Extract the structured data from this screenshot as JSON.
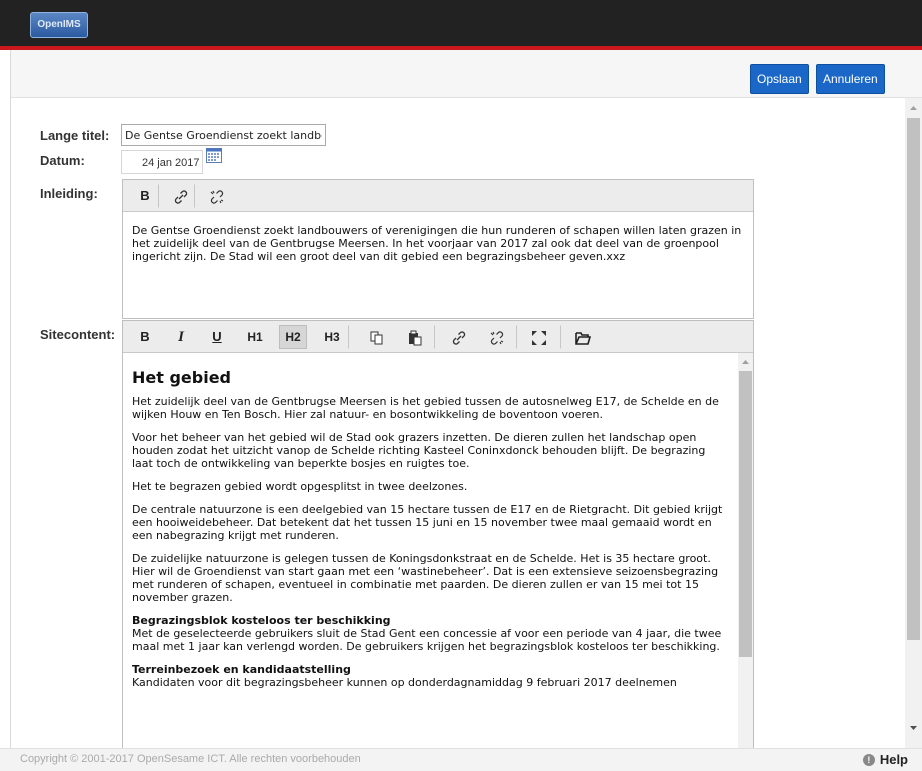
{
  "app": {
    "logo_text": "OpenIMS"
  },
  "actions": {
    "save_label": "Opslaan",
    "cancel_label": "Annuleren"
  },
  "form": {
    "long_title_label": "Lange titel:",
    "long_title_value": "De Gentse Groendienst zoekt landbc",
    "date_label": "Datum:",
    "date_value": "24 jan 2017",
    "intro_label": "Inleiding:",
    "intro_text": "De Gentse Groendienst zoekt landbouwers of verenigingen die hun runderen of schapen willen laten grazen in het zuidelijk deel van de Gentbrugse Meersen. In het voorjaar van 2017 zal ook dat deel van de groenpool ingericht zijn. De Stad wil een groot deel van dit gebied een begrazingsbeheer geven.xxz",
    "sitecontent_label": "Sitecontent:"
  },
  "intro_toolbar": {
    "bold": "B"
  },
  "site_toolbar": {
    "bold": "B",
    "italic": "I",
    "underline": "U",
    "h1": "H1",
    "h2": "H2",
    "h3": "H3"
  },
  "content": {
    "heading": "Het gebied",
    "p1": "Het zuidelijk deel van de Gentbrugse Meersen is het gebied tussen de autosnelweg E17, de Schelde en de wijken Houw en Ten Bosch. Hier zal natuur- en bosontwikkeling de boventoon voeren.",
    "p2": "Voor het beheer van het gebied wil de Stad ook grazers inzetten. De dieren zullen het landschap open houden zodat het uitzicht vanop de Schelde richting Kasteel Coninxdonck behouden blijft. De begrazing laat toch de ontwikkeling van beperkte bosjes en ruigtes toe.",
    "p3": "Het te begrazen gebied wordt opgesplitst in twee deelzones.",
    "p4": "De centrale natuurzone is een deelgebied van 15 hectare tussen de E17 en de Rietgracht. Dit gebied krijgt een hooiweidebeheer. Dat betekent dat het tussen 15 juni en 15 november twee maal gemaaid wordt en een nabegrazing krijgt met runderen.",
    "p5": "De zuidelijke natuurzone is gelegen tussen de Koningsdonkstraat en de Schelde. Het is 35 hectare groot. Hier wil de Groendienst van start gaan met een ‘wastinebeheer’. Dat is een extensieve seizoensbegrazing met runderen of schapen, eventueel in combinatie met paarden. De dieren zullen er van 15 mei tot 15 november grazen.",
    "h_block": "Begrazingsblok kosteloos ter beschikking",
    "p6": "Met de geselecteerde gebruikers sluit de Stad Gent een concessie af voor een periode van 4 jaar, die twee maal met 1 jaar kan verlengd worden. De gebruikers krijgen het begrazingsblok kosteloos ter beschikking.",
    "h_visit": "Terreinbezoek en kandidaatstelling",
    "p7": "Kandidaten voor dit begrazingsbeheer kunnen op donderdagnamiddag 9 februari 2017 deelnemen"
  },
  "footer": {
    "copyright": "Copyright © 2001-2017 OpenSesame ICT. Alle rechten voorbehouden",
    "help_label": "Help",
    "help_glyph": "!"
  },
  "colors": {
    "accent": "#c8181d",
    "button": "#1a67c8",
    "topbar": "#222222"
  }
}
